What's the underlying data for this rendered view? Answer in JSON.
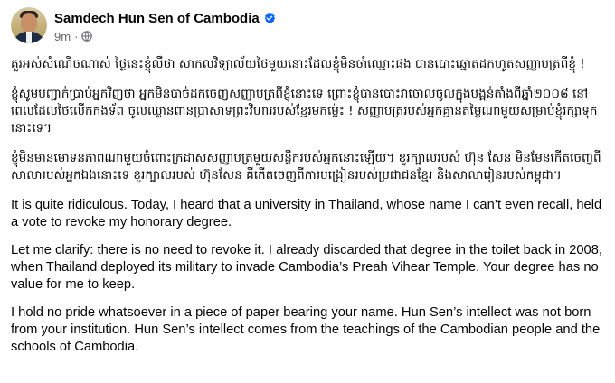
{
  "post": {
    "author": "Samdech Hun Sen of Cambodia",
    "timestamp": "9m",
    "separator": "·",
    "audience_icon": "globe-icon",
    "verified_icon": "verified-badge-icon",
    "avatar_icon": "profile-photo"
  },
  "body": {
    "km_paragraphs": [
      "គួរអស់សំណើចណាស់ ថ្ងៃនេះខ្ញុំលឺថា សាកលវិទ្យាល័យថៃមួយនោះដែលខ្ញុំមិនចាំឈ្មោះផង បានបោះឆ្នោតដកហូតសញ្ញាបត្រពីខ្ញុំ !",
      "ខ្ញុំសូមបញ្ជាក់ប្រាប់អ្នកវិញថា អ្នកមិនបាច់ដកចេញសញ្ញាបត្រពីខ្ញុំនោះទេ ព្រោះខ្ញុំបានបោះវាចោលចូលក្នុងបង្គន់តាំងពីឆ្នាំ២០០៨ នៅពេលដែលថៃលើកកងទ័ព ចូលឈ្លានពានប្រាសាទព្រះវិហាររបស់ខ្មែរមកម្ល៉េះ ! សញ្ញាបត្ររបស់អ្នកគ្មានតម្លៃណាមួយសម្រាប់ខ្ញុំរក្សាទុកនោះទេ។",
      "ខ្ញុំមិនមានមោទនភាពណាមួយចំពោះក្រដាសសញ្ញាបត្រមួយសន្លឹករបស់អ្នកនោះឡើយ។ ខួរក្បាលរបស់ ហ៊ុន សែន មិនមែនកើតចេញពីសាលារបស់អ្នកឯងនោះទេ ខួរក្បាលរបស់ ហ៊ុនសែន គឺកើតចេញពីការបង្រៀនរបស់ប្រជាជនខ្មែរ និងសាលារៀនរបស់កម្ពុជា។"
    ],
    "en_paragraphs": [
      "It is quite ridiculous. Today, I heard that a university in Thailand, whose name I can’t even recall, held a vote to revoke my honorary degree.",
      "Let me clarify: there is no need to revoke it. I already discarded that degree in the toilet back in 2008, when Thailand deployed its military to invade Cambodia’s Preah Vihear Temple. Your degree has no value for me to keep.",
      "I hold no pride whatsoever in a piece of paper bearing your name. Hun Sen’s intellect was not born from your institution. Hun Sen’s intellect comes from the teachings of the Cambodian people and the schools of Cambodia."
    ]
  }
}
